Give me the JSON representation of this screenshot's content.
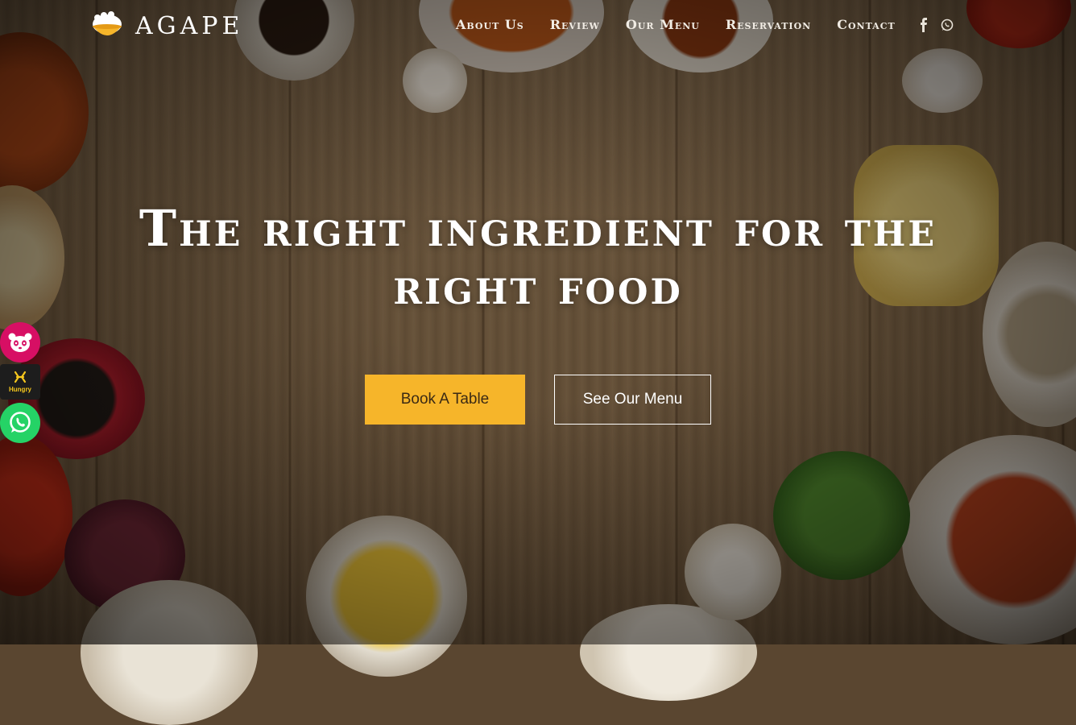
{
  "brand": {
    "name": "AGAPE",
    "logo_icon": "rice-bowl-icon"
  },
  "nav": {
    "items": [
      {
        "label": "About Us"
      },
      {
        "label": "Review"
      },
      {
        "label": "Our Menu"
      },
      {
        "label": "Reservation"
      },
      {
        "label": "Contact"
      }
    ],
    "social": [
      {
        "icon": "facebook-icon"
      },
      {
        "icon": "whatsapp-icon"
      }
    ]
  },
  "hero": {
    "title": "The right ingredient for the right food",
    "book_label": "Book A Table",
    "menu_label": "See Our Menu"
  },
  "floating": {
    "foodpanda_icon": "foodpanda-icon",
    "hungry_label": "Hungry",
    "whatsapp_icon": "whatsapp-icon"
  },
  "colors": {
    "accent": "#f6b52a",
    "foodpanda": "#d70f64",
    "whatsapp": "#25d366",
    "hungry": "#f6c71d"
  }
}
